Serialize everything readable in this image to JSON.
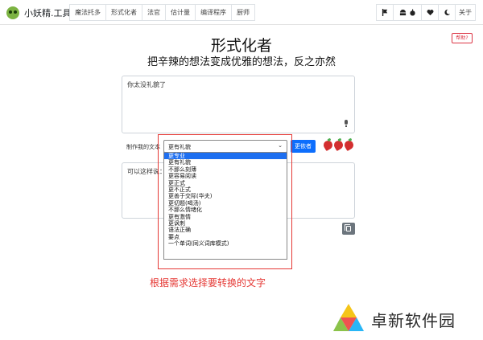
{
  "brand": {
    "name": "小妖精.工具"
  },
  "nav_tools": [
    "魔法托多",
    "形式化者",
    "法官",
    "估计量",
    "编译程序",
    "厨师"
  ],
  "nav_right": {
    "about_label": "关于"
  },
  "header": {
    "title": "形式化者",
    "subtitle": "把辛辣的想法变成优雅的想法，反之亦然",
    "help_label": "帮助?"
  },
  "input": {
    "value": "你太没礼貌了"
  },
  "controls": {
    "make_label": "制作我的文本",
    "selected": "更有礼貌",
    "rewrite_label": "更依者"
  },
  "dropdown_options": [
    "更专业",
    "更有礼貌",
    "不那么刻薄",
    "更容易阅读",
    "更正式",
    "更不正式",
    "更善于交际(华夫)",
    "更切题(喝汤)",
    "不那么情绪化",
    "更有激情",
    "更讽刺",
    "语法正确",
    "要点",
    "一个单词(同义词库模式)"
  ],
  "dropdown_highlighted_index": 0,
  "output": {
    "value": "可以这样说："
  },
  "annotation": {
    "text": "根据需求选择要转换的文字"
  },
  "watermark": {
    "text": "卓新软件园"
  },
  "colors": {
    "accent": "#0d6efd",
    "annotation": "#e53935",
    "highlight": "#1e6ff0"
  }
}
